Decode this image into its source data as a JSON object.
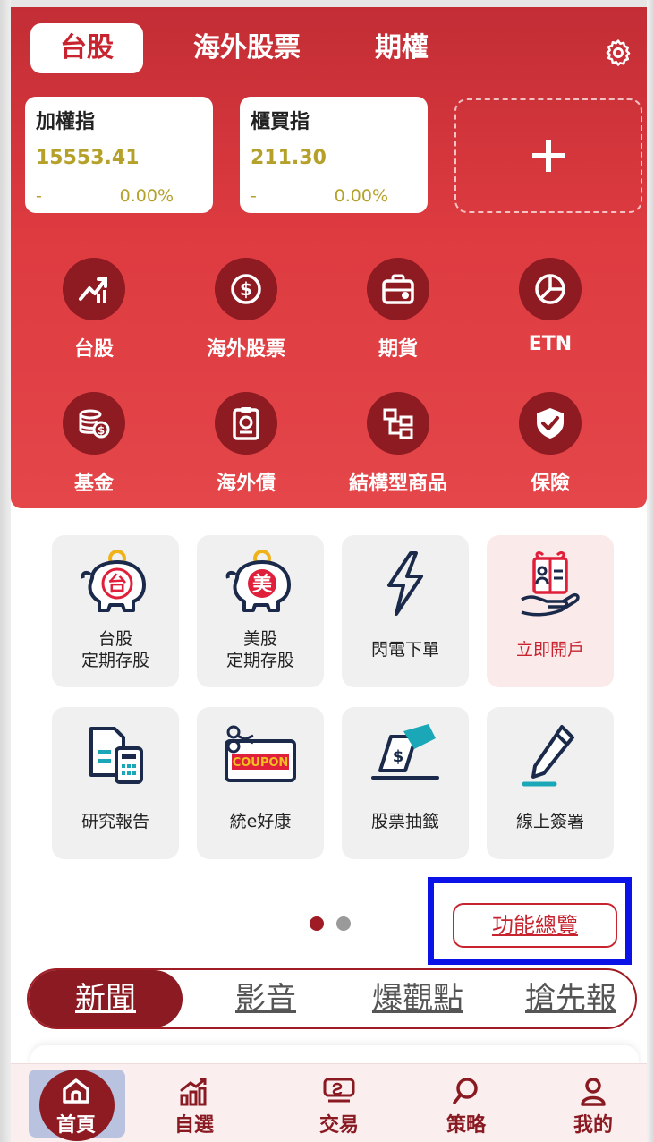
{
  "market_tabs": [
    "台股",
    "海外股票",
    "期權"
  ],
  "indices": [
    {
      "name": "加權指",
      "value": "15553.41",
      "change": "-",
      "percent": "0.00%"
    },
    {
      "name": "櫃買指",
      "value": "211.30",
      "change": "-",
      "percent": "0.00%"
    }
  ],
  "add_card_symbol": "+",
  "categories": [
    {
      "label": "台股",
      "icon": "trend-chart-icon"
    },
    {
      "label": "海外股票",
      "icon": "dollar-coin-icon"
    },
    {
      "label": "期貨",
      "icon": "briefcase-icon"
    },
    {
      "label": "ETN",
      "icon": "pie-chart-icon"
    },
    {
      "label": "基金",
      "icon": "coin-stack-icon"
    },
    {
      "label": "海外債",
      "icon": "bond-document-icon"
    },
    {
      "label": "結構型商品",
      "icon": "structure-tree-icon"
    },
    {
      "label": "保險",
      "icon": "shield-check-icon"
    }
  ],
  "tiles": [
    {
      "line1": "台股",
      "line2": "定期存股",
      "icon": "piggy-bank-tw-icon",
      "badge": "台"
    },
    {
      "line1": "美股",
      "line2": "定期存股",
      "icon": "piggy-bank-us-icon",
      "badge": "美"
    },
    {
      "line1": "閃電下單",
      "line2": "",
      "icon": "lightning-icon"
    },
    {
      "line1": "立即開戶",
      "line2": "",
      "icon": "open-account-icon"
    },
    {
      "line1": "研究報告",
      "line2": "",
      "icon": "report-calculator-icon"
    },
    {
      "line1": "統e好康",
      "line2": "",
      "icon": "coupon-icon",
      "coupon_text": "COUPON"
    },
    {
      "line1": "股票抽籤",
      "line2": "",
      "icon": "lottery-ticket-icon"
    },
    {
      "line1": "線上簽署",
      "line2": "",
      "icon": "pen-sign-icon"
    }
  ],
  "pagination": {
    "current": 1,
    "total": 2
  },
  "overview_button": "功能總覽",
  "news_tabs": [
    "新聞",
    "影音",
    "爆觀點",
    "搶先報"
  ],
  "bottom_nav": [
    {
      "label": "首頁",
      "icon": "home-icon"
    },
    {
      "label": "自選",
      "icon": "watchlist-chart-icon"
    },
    {
      "label": "交易",
      "icon": "trade-icon"
    },
    {
      "label": "策略",
      "icon": "search-icon"
    },
    {
      "label": "我的",
      "icon": "user-icon"
    }
  ],
  "colors": {
    "brand_red": "#c8242f",
    "dark_red": "#8e1a22",
    "index_value": "#b5a12a",
    "highlight_box": "#0a12e8"
  }
}
